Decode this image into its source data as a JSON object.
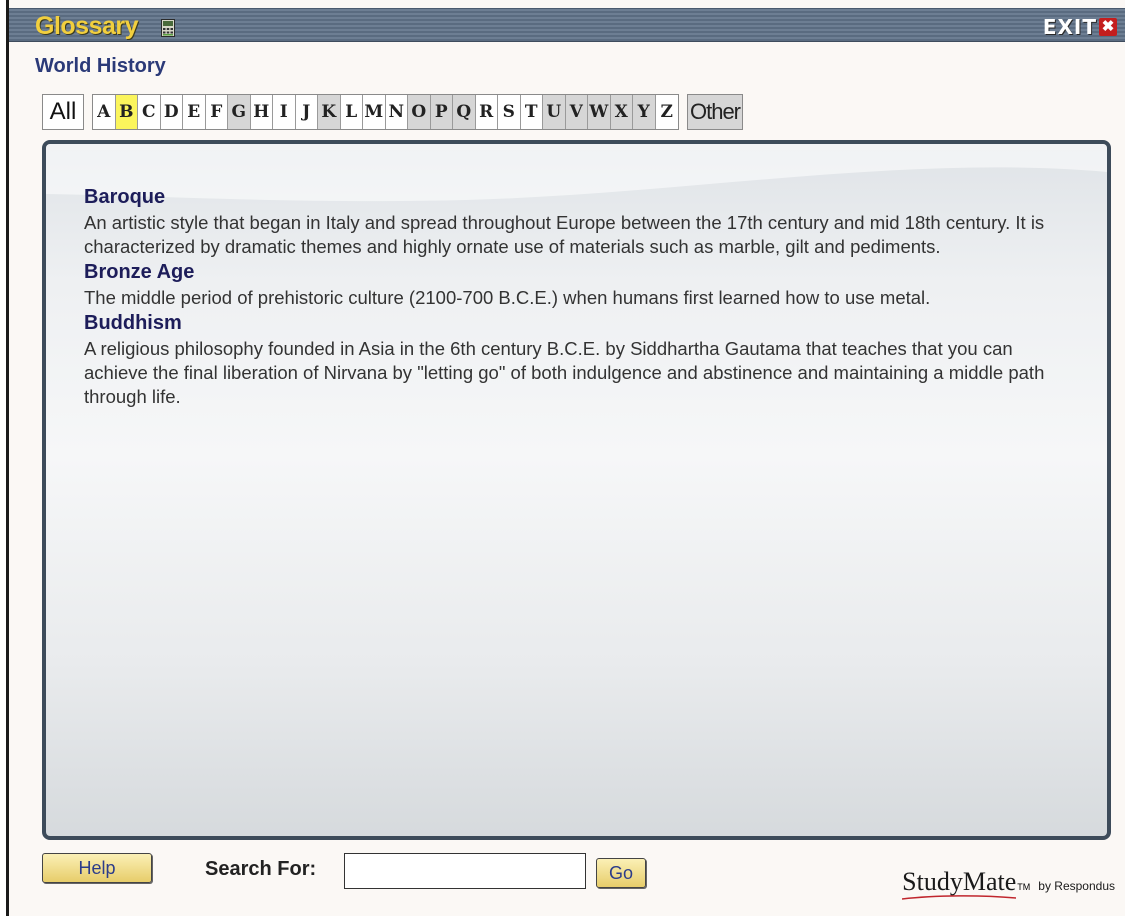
{
  "window": {
    "title": "Glossary",
    "exit_label": "EXIT",
    "exit_icon_glyph": "✖"
  },
  "subject": "World History",
  "alphabet": {
    "all_label": "All",
    "letters": [
      {
        "char": "A",
        "enabled": true
      },
      {
        "char": "B",
        "enabled": true,
        "selected": true
      },
      {
        "char": "C",
        "enabled": true
      },
      {
        "char": "D",
        "enabled": true
      },
      {
        "char": "E",
        "enabled": true
      },
      {
        "char": "F",
        "enabled": true
      },
      {
        "char": "G",
        "enabled": false
      },
      {
        "char": "H",
        "enabled": true
      },
      {
        "char": "I",
        "enabled": true
      },
      {
        "char": "J",
        "enabled": true
      },
      {
        "char": "K",
        "enabled": false
      },
      {
        "char": "L",
        "enabled": true
      },
      {
        "char": "M",
        "enabled": true
      },
      {
        "char": "N",
        "enabled": true
      },
      {
        "char": "O",
        "enabled": false
      },
      {
        "char": "P",
        "enabled": false
      },
      {
        "char": "Q",
        "enabled": false
      },
      {
        "char": "R",
        "enabled": true
      },
      {
        "char": "S",
        "enabled": true
      },
      {
        "char": "T",
        "enabled": true
      },
      {
        "char": "U",
        "enabled": false
      },
      {
        "char": "V",
        "enabled": false
      },
      {
        "char": "W",
        "enabled": false
      },
      {
        "char": "X",
        "enabled": false
      },
      {
        "char": "Y",
        "enabled": false
      },
      {
        "char": "Z",
        "enabled": true
      }
    ],
    "other_label": "Other"
  },
  "entries": [
    {
      "term": "Baroque",
      "definition": "An artistic style that began in Italy and spread throughout Europe between the 17th century and mid 18th century. It is characterized by dramatic themes and highly ornate use of materials such as marble, gilt and pediments."
    },
    {
      "term": "Bronze Age",
      "definition": "The middle period of prehistoric culture (2100-700 B.C.E.) when humans first learned how to use metal."
    },
    {
      "term": "Buddhism",
      "definition": "A religious philosophy founded in Asia in the 6th century B.C.E. by Siddhartha Gautama that teaches that you can achieve the final liberation of Nirvana by \"letting go\" of both indulgence and abstinence and maintaining a middle path through life."
    }
  ],
  "footer": {
    "help_label": "Help",
    "search_label": "Search For:",
    "search_value": "",
    "go_label": "Go",
    "brand_name": "StudyMate",
    "brand_tm": "TM",
    "brand_by": "by Respondus"
  },
  "colors": {
    "title_text": "#f2cf3e",
    "subject_text": "#2b3a78",
    "selected_letter": "#fbf55c",
    "disabled_letter": "#d6d6d6",
    "term_text": "#1d1d5a",
    "content_border": "#3d4b5a",
    "exit_icon_bg": "#c41e1e"
  },
  "icons": {
    "title_icon": "calculator-icon",
    "exit_icon": "close-icon"
  }
}
